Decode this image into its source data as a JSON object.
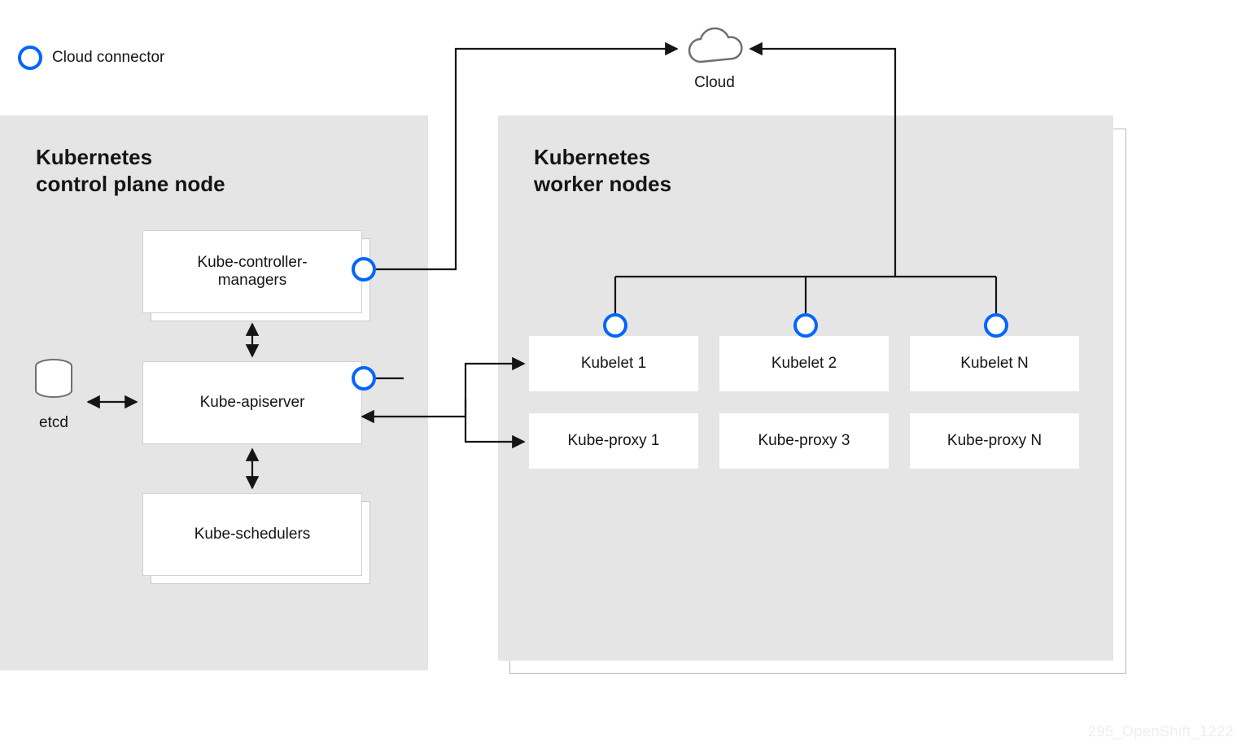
{
  "legend": {
    "label": "Cloud connector"
  },
  "cloud": {
    "label": "Cloud"
  },
  "control_plane": {
    "title": "Kubernetes\ncontrol plane node",
    "boxes": {
      "controller": "Kube-controller-\nmanagers",
      "apiserver": "Kube-apiserver",
      "scheduler": "Kube-schedulers"
    },
    "etcd_label": "etcd"
  },
  "worker": {
    "title": "Kubernetes\nworker nodes",
    "kubelets": [
      "Kubelet 1",
      "Kubelet 2",
      "Kubelet N"
    ],
    "proxies": [
      "Kube-proxy 1",
      "Kube-proxy 3",
      "Kube-proxy N"
    ]
  },
  "watermark": "295_OpenShift_1222",
  "colors": {
    "accent": "#0066ff",
    "panel": "#e5e5e5",
    "text": "#151515"
  }
}
